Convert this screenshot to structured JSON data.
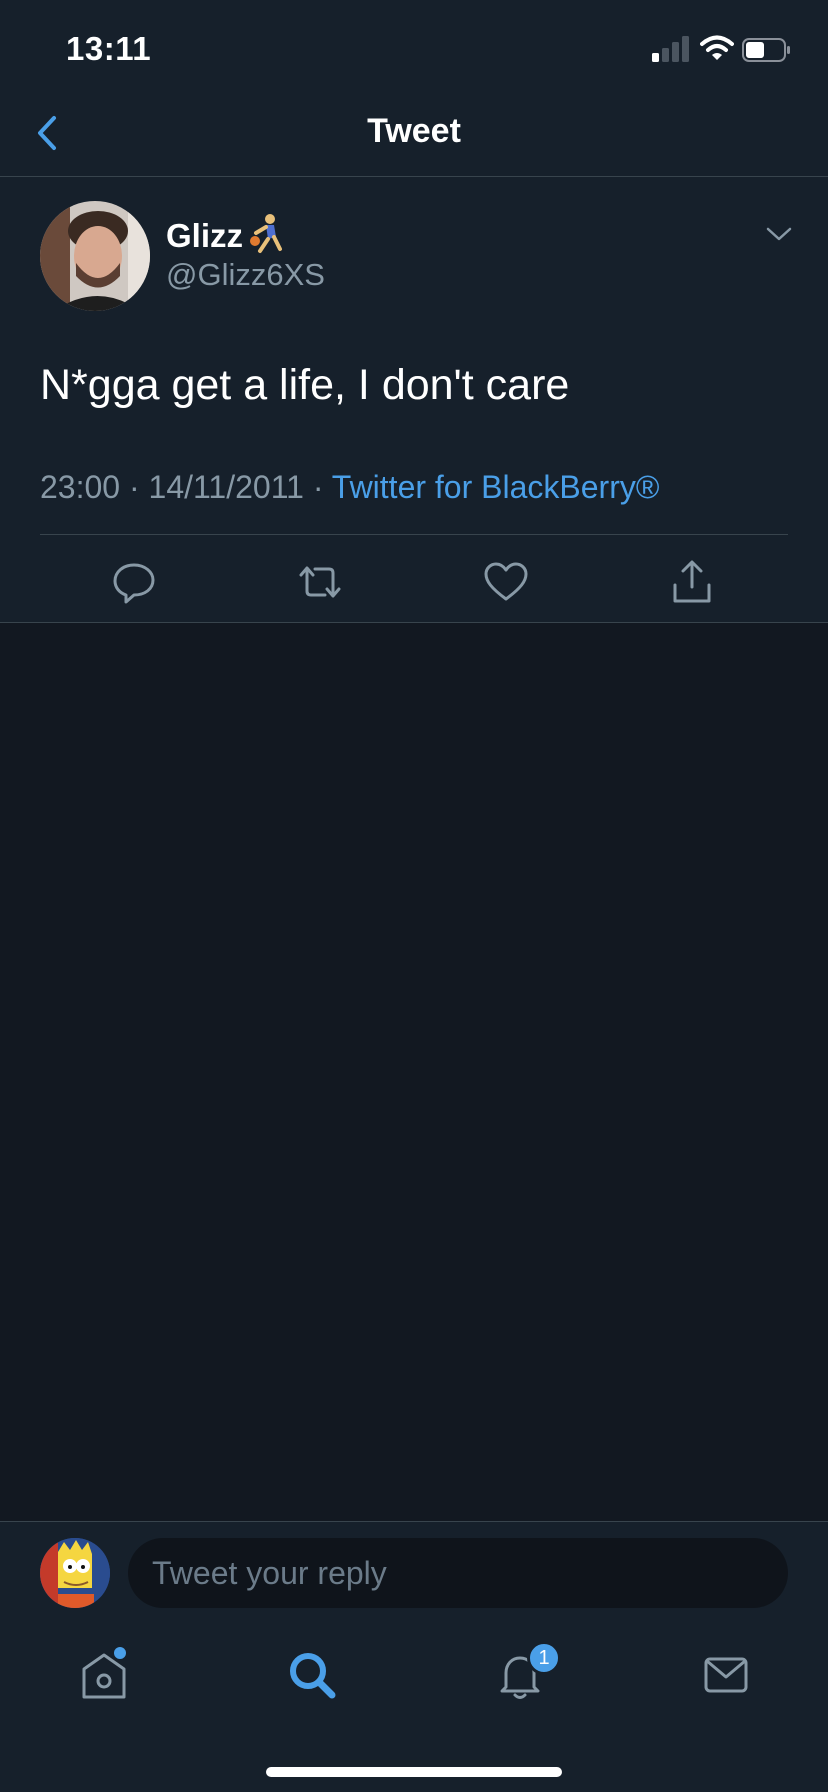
{
  "status_bar": {
    "time": "13:11",
    "icons": [
      "signal-icon",
      "wifi-icon",
      "battery-icon"
    ]
  },
  "header": {
    "title": "Tweet",
    "back_icon": "chevron-left-icon"
  },
  "tweet": {
    "display_name": "Glizz",
    "name_emoji": "basketball-player-emoji",
    "handle": "@Glizz6XS",
    "text": "N*gga get a life, I don't care",
    "time": "23:00",
    "date": "14/11/2011",
    "separator": "·",
    "source": "Twitter for BlackBerry®",
    "actions": [
      "reply-icon",
      "retweet-icon",
      "like-icon",
      "share-icon"
    ]
  },
  "reply": {
    "placeholder": "Tweet your reply"
  },
  "tab_bar": {
    "tabs": [
      "home-icon",
      "search-icon",
      "notifications-icon",
      "messages-icon"
    ],
    "notification_count": "1"
  },
  "colors": {
    "background": "#121821",
    "surface": "#16202b",
    "accent": "#4a9fe8",
    "muted_text": "#8899a6",
    "border": "#38444d"
  }
}
